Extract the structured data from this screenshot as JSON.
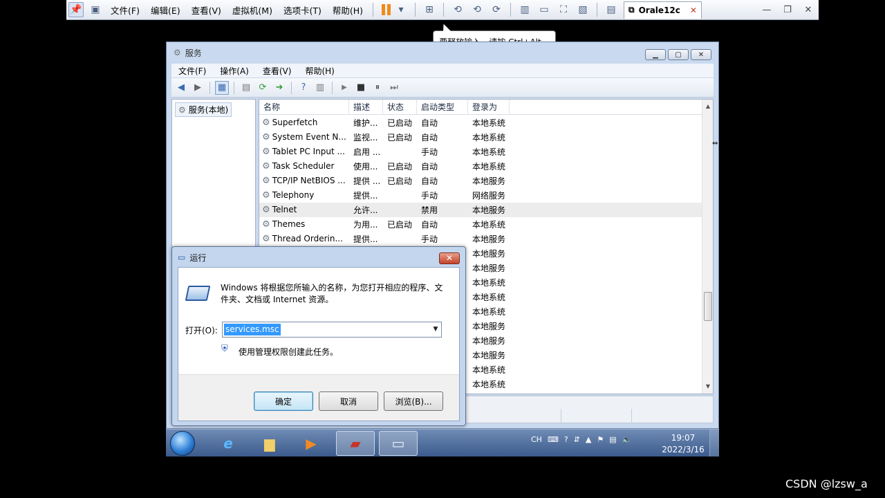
{
  "vmware": {
    "menu": [
      "文件(F)",
      "编辑(E)",
      "查看(V)",
      "虚拟机(M)",
      "选项卡(T)",
      "帮助(H)"
    ],
    "tab_label": "Orale12c",
    "tooltip": "要释放输入，请按 Ctrl+Alt。"
  },
  "services": {
    "title": "服务",
    "menu": [
      "文件(F)",
      "操作(A)",
      "查看(V)",
      "帮助(H)"
    ],
    "tree_node": "服务(本地)",
    "columns": [
      "名称",
      "描述",
      "状态",
      "启动类型",
      "登录为"
    ],
    "rows": [
      {
        "name": "Superfetch",
        "desc": "维护...",
        "status": "已启动",
        "startup": "自动",
        "logon": "本地系统"
      },
      {
        "name": "System Event N...",
        "desc": "监视...",
        "status": "已启动",
        "startup": "自动",
        "logon": "本地系统"
      },
      {
        "name": "Tablet PC Input ...",
        "desc": "启用 ...",
        "status": "",
        "startup": "手动",
        "logon": "本地系统"
      },
      {
        "name": "Task Scheduler",
        "desc": "使用...",
        "status": "已启动",
        "startup": "自动",
        "logon": "本地系统"
      },
      {
        "name": "TCP/IP NetBIOS ...",
        "desc": "提供 ...",
        "status": "已启动",
        "startup": "自动",
        "logon": "本地服务"
      },
      {
        "name": "Telephony",
        "desc": "提供...",
        "status": "",
        "startup": "手动",
        "logon": "网络服务"
      },
      {
        "name": "Telnet",
        "desc": "允许...",
        "status": "",
        "startup": "禁用",
        "logon": "本地服务"
      },
      {
        "name": "Themes",
        "desc": "为用...",
        "status": "已启动",
        "startup": "自动",
        "logon": "本地系统"
      },
      {
        "name": "Thread Orderin...",
        "desc": "提供...",
        "status": "",
        "startup": "手动",
        "logon": "本地服务"
      },
      {
        "name": "",
        "desc": "",
        "status": "",
        "startup": "",
        "logon": "本地服务"
      },
      {
        "name": "",
        "desc": "",
        "status": "",
        "startup": "",
        "logon": "本地服务"
      },
      {
        "name": "",
        "desc": "",
        "status": "",
        "startup": "",
        "logon": "本地系统"
      },
      {
        "name": "",
        "desc": "",
        "status": "",
        "startup": "",
        "logon": "本地系统"
      },
      {
        "name": "",
        "desc": "",
        "status": "",
        "startup": "",
        "logon": "本地系统"
      },
      {
        "name": "",
        "desc": "",
        "status": "",
        "startup": "",
        "logon": "本地服务"
      },
      {
        "name": "",
        "desc": "",
        "status": "",
        "startup": "",
        "logon": "本地服务"
      },
      {
        "name": "",
        "desc": "",
        "status": "",
        "startup": "",
        "logon": "本地服务"
      },
      {
        "name": "",
        "desc": "",
        "status": "",
        "startup": "",
        "logon": "本地系统"
      },
      {
        "name": "",
        "desc": "",
        "status": "",
        "startup": "",
        "logon": "本地系统"
      }
    ]
  },
  "run_dialog": {
    "title": "运行",
    "description": "Windows 将根据您所输入的名称，为您打开相应的程序、文件夹、文档或 Internet 资源。",
    "open_label": "打开(O):",
    "input_value": "services.msc",
    "admin_note": "使用管理权限创建此任务。",
    "ok": "确定",
    "cancel": "取消",
    "browse": "浏览(B)..."
  },
  "taskbar": {
    "lang": "CH",
    "time": "19:07",
    "date": "2022/3/16"
  },
  "watermark": "CSDN @lzsw_a"
}
